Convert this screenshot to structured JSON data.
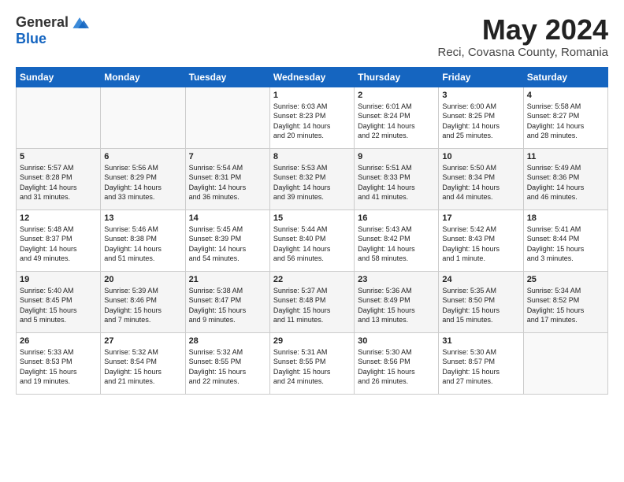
{
  "header": {
    "logo_general": "General",
    "logo_blue": "Blue",
    "month_title": "May 2024",
    "subtitle": "Reci, Covasna County, Romania"
  },
  "days_of_week": [
    "Sunday",
    "Monday",
    "Tuesday",
    "Wednesday",
    "Thursday",
    "Friday",
    "Saturday"
  ],
  "weeks": [
    [
      {
        "day": "",
        "info": ""
      },
      {
        "day": "",
        "info": ""
      },
      {
        "day": "",
        "info": ""
      },
      {
        "day": "1",
        "info": "Sunrise: 6:03 AM\nSunset: 8:23 PM\nDaylight: 14 hours\nand 20 minutes."
      },
      {
        "day": "2",
        "info": "Sunrise: 6:01 AM\nSunset: 8:24 PM\nDaylight: 14 hours\nand 22 minutes."
      },
      {
        "day": "3",
        "info": "Sunrise: 6:00 AM\nSunset: 8:25 PM\nDaylight: 14 hours\nand 25 minutes."
      },
      {
        "day": "4",
        "info": "Sunrise: 5:58 AM\nSunset: 8:27 PM\nDaylight: 14 hours\nand 28 minutes."
      }
    ],
    [
      {
        "day": "5",
        "info": "Sunrise: 5:57 AM\nSunset: 8:28 PM\nDaylight: 14 hours\nand 31 minutes."
      },
      {
        "day": "6",
        "info": "Sunrise: 5:56 AM\nSunset: 8:29 PM\nDaylight: 14 hours\nand 33 minutes."
      },
      {
        "day": "7",
        "info": "Sunrise: 5:54 AM\nSunset: 8:31 PM\nDaylight: 14 hours\nand 36 minutes."
      },
      {
        "day": "8",
        "info": "Sunrise: 5:53 AM\nSunset: 8:32 PM\nDaylight: 14 hours\nand 39 minutes."
      },
      {
        "day": "9",
        "info": "Sunrise: 5:51 AM\nSunset: 8:33 PM\nDaylight: 14 hours\nand 41 minutes."
      },
      {
        "day": "10",
        "info": "Sunrise: 5:50 AM\nSunset: 8:34 PM\nDaylight: 14 hours\nand 44 minutes."
      },
      {
        "day": "11",
        "info": "Sunrise: 5:49 AM\nSunset: 8:36 PM\nDaylight: 14 hours\nand 46 minutes."
      }
    ],
    [
      {
        "day": "12",
        "info": "Sunrise: 5:48 AM\nSunset: 8:37 PM\nDaylight: 14 hours\nand 49 minutes."
      },
      {
        "day": "13",
        "info": "Sunrise: 5:46 AM\nSunset: 8:38 PM\nDaylight: 14 hours\nand 51 minutes."
      },
      {
        "day": "14",
        "info": "Sunrise: 5:45 AM\nSunset: 8:39 PM\nDaylight: 14 hours\nand 54 minutes."
      },
      {
        "day": "15",
        "info": "Sunrise: 5:44 AM\nSunset: 8:40 PM\nDaylight: 14 hours\nand 56 minutes."
      },
      {
        "day": "16",
        "info": "Sunrise: 5:43 AM\nSunset: 8:42 PM\nDaylight: 14 hours\nand 58 minutes."
      },
      {
        "day": "17",
        "info": "Sunrise: 5:42 AM\nSunset: 8:43 PM\nDaylight: 15 hours\nand 1 minute."
      },
      {
        "day": "18",
        "info": "Sunrise: 5:41 AM\nSunset: 8:44 PM\nDaylight: 15 hours\nand 3 minutes."
      }
    ],
    [
      {
        "day": "19",
        "info": "Sunrise: 5:40 AM\nSunset: 8:45 PM\nDaylight: 15 hours\nand 5 minutes."
      },
      {
        "day": "20",
        "info": "Sunrise: 5:39 AM\nSunset: 8:46 PM\nDaylight: 15 hours\nand 7 minutes."
      },
      {
        "day": "21",
        "info": "Sunrise: 5:38 AM\nSunset: 8:47 PM\nDaylight: 15 hours\nand 9 minutes."
      },
      {
        "day": "22",
        "info": "Sunrise: 5:37 AM\nSunset: 8:48 PM\nDaylight: 15 hours\nand 11 minutes."
      },
      {
        "day": "23",
        "info": "Sunrise: 5:36 AM\nSunset: 8:49 PM\nDaylight: 15 hours\nand 13 minutes."
      },
      {
        "day": "24",
        "info": "Sunrise: 5:35 AM\nSunset: 8:50 PM\nDaylight: 15 hours\nand 15 minutes."
      },
      {
        "day": "25",
        "info": "Sunrise: 5:34 AM\nSunset: 8:52 PM\nDaylight: 15 hours\nand 17 minutes."
      }
    ],
    [
      {
        "day": "26",
        "info": "Sunrise: 5:33 AM\nSunset: 8:53 PM\nDaylight: 15 hours\nand 19 minutes."
      },
      {
        "day": "27",
        "info": "Sunrise: 5:32 AM\nSunset: 8:54 PM\nDaylight: 15 hours\nand 21 minutes."
      },
      {
        "day": "28",
        "info": "Sunrise: 5:32 AM\nSunset: 8:55 PM\nDaylight: 15 hours\nand 22 minutes."
      },
      {
        "day": "29",
        "info": "Sunrise: 5:31 AM\nSunset: 8:55 PM\nDaylight: 15 hours\nand 24 minutes."
      },
      {
        "day": "30",
        "info": "Sunrise: 5:30 AM\nSunset: 8:56 PM\nDaylight: 15 hours\nand 26 minutes."
      },
      {
        "day": "31",
        "info": "Sunrise: 5:30 AM\nSunset: 8:57 PM\nDaylight: 15 hours\nand 27 minutes."
      },
      {
        "day": "",
        "info": ""
      }
    ]
  ]
}
